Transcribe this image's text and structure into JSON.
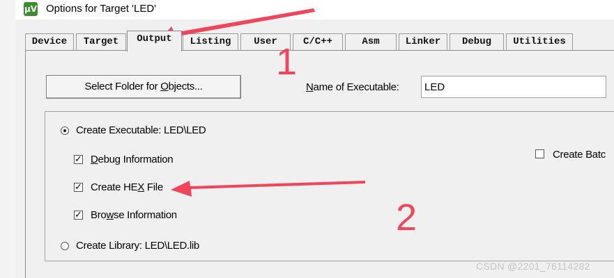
{
  "window": {
    "title": "Options for Target 'LED'",
    "icon": "keil-uvision-icon"
  },
  "tabs": [
    {
      "label": "Device",
      "active": false
    },
    {
      "label": "Target",
      "active": false
    },
    {
      "label": "Output",
      "active": true
    },
    {
      "label": "Listing",
      "active": false
    },
    {
      "label": "User",
      "active": false
    },
    {
      "label": "C/C++",
      "active": false
    },
    {
      "label": "Asm",
      "active": false
    },
    {
      "label": "Linker",
      "active": false
    },
    {
      "label": "Debug",
      "active": false
    },
    {
      "label": "Utilities",
      "active": false
    }
  ],
  "output": {
    "select_folder_pre": "Select Folder for ",
    "select_folder_u": "O",
    "select_folder_post": "bjects...",
    "name_label_u": "N",
    "name_label_post": "ame of Executable:",
    "name_value": "LED",
    "create_exec_label": "Create Executable:  LED\\LED",
    "create_exec_selected": true,
    "debug_u": "D",
    "debug_post": "ebug Information",
    "debug_checked": true,
    "hex_pre": "Create HE",
    "hex_u": "X",
    "hex_post": " File",
    "hex_checked": true,
    "browse_pre": "Bro",
    "browse_u": "w",
    "browse_post": "se Information",
    "browse_checked": true,
    "create_lib_label": "Create Library:  LED\\LED.lib",
    "create_lib_selected": false,
    "batch_label": "Create Batc",
    "batch_checked": false
  },
  "annotations": {
    "num1": "1",
    "num2": "2",
    "color": "#f0455a"
  },
  "watermark": "CSDN @2201_76114282"
}
